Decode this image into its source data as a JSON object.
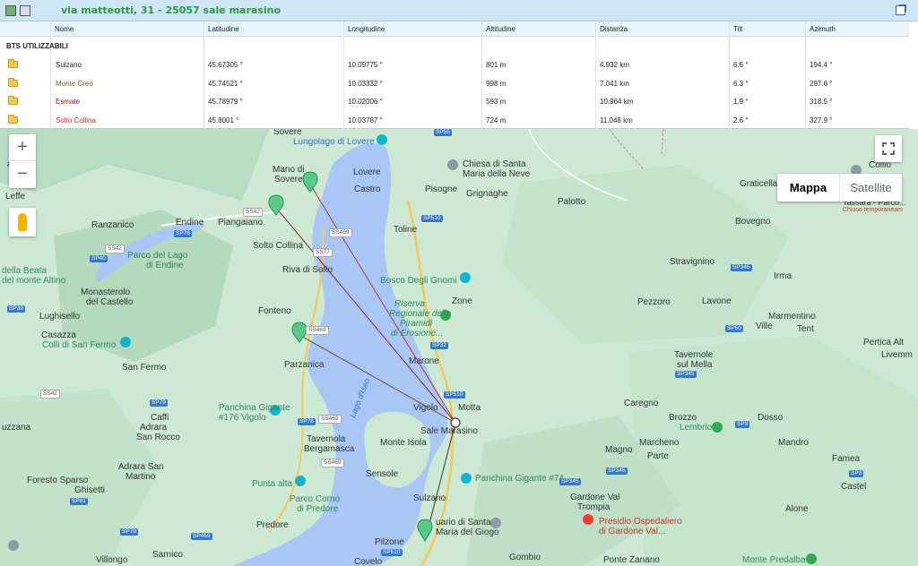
{
  "header": {
    "address": "via matteotti, 31 - 25057 sale marasino",
    "icons": [
      "map-icon",
      "print-icon",
      "external-link-icon"
    ]
  },
  "table": {
    "columns": [
      "Nome",
      "Latitudine",
      "Longitudine",
      "Altitudine",
      "Distanza",
      "Tilt",
      "Azimuth"
    ],
    "group_label": "BTS UTILIZZABILI",
    "rows": [
      {
        "name": "Sulzano",
        "lat": "45.67305 °",
        "lon": "10.09775 °",
        "alt": "801 m",
        "dist": "4.932 km",
        "tilt": "6.6 °",
        "az": "194.4 °",
        "color": "#222222"
      },
      {
        "name": "Monte Creò",
        "lat": "45.74521 °",
        "lon": "10.03332 °",
        "alt": "998 m",
        "dist": "7.041 km",
        "tilt": "6.3 °",
        "az": "297.6 °",
        "color": "#7a5a2a"
      },
      {
        "name": "Esmate",
        "lat": "45.78979 °",
        "lon": "10.02006 °",
        "alt": "593 m",
        "dist": "10.964 km",
        "tilt": "1.9 °",
        "az": "318.5 °",
        "color": "#8b1a1a"
      },
      {
        "name": "Solto Collina",
        "lat": "45.8001 °",
        "lon": "10.03787 °",
        "alt": "724 m",
        "dist": "11.048 km",
        "tilt": "2.6 °",
        "az": "327.9 °",
        "color": "#d42a2a"
      }
    ]
  },
  "map": {
    "controls": {
      "zoom_in": "+",
      "zoom_out": "−",
      "map_label": "Mappa",
      "satellite_label": "Satellite"
    },
    "places": {
      "sovere": "Sovere",
      "lungolago": "Lungolago di Lovere",
      "mano_di": "Mano di",
      "sovere2": "Sovere",
      "lovere": "Lovere",
      "chiesa1": "Chiesa di Santa",
      "chiesa2": "Maria della Neve",
      "castro": "Castro",
      "pisogne": "Pisogne",
      "grignaghe": "Grignaghe",
      "palotto": "Palotto",
      "collio": "Collio",
      "graticella": "Graticella",
      "bovegno": "Bovegno",
      "ndino": "andino",
      "leffe": "Leffe",
      "ranzanico": "Ranzanico",
      "endine": "Endine",
      "piangaiano": "Piangaiano",
      "solto": "Solto Collina",
      "toline": "Toline",
      "parco1": "Parco del Lago",
      "parco2": "di Endine",
      "riva": "Riva di Solto",
      "beata1": "della Beata",
      "beata2": "del monte Altino",
      "monasterolo1": "Monasterolo",
      "monasterolo2": "del Castello",
      "bosco": "Bosco Degli Gnomi",
      "zone": "Zone",
      "riserva1": "Riserva",
      "riserva2": "Regionale delle",
      "riserva3": "Piramidi",
      "riserva4": "di Erosione...",
      "stravignino": "Stravignino",
      "irma": "Irma",
      "pezzoro": "Pezzoro",
      "lavone": "Lavone",
      "marmentino": "Marmentino",
      "ville": "Ville",
      "tent": "Tent",
      "lughisello": "Lughisello",
      "fonteno": "Fonteno",
      "casazza": "Casazza",
      "colli": "Colli di San Fermo",
      "pertica1": "Pertica Alt",
      "pertica2": "Livemm",
      "marone": "Marone",
      "parzanica": "Parzanica",
      "tavernole1": "Tavernole",
      "tavernole2": "sul Mella",
      "sanfermo": "San Fermo",
      "lagodiseo": "Lago d'Iseo",
      "caregno": "Caregno",
      "vigolo": "Vigolo",
      "motta": "Motta",
      "panchina1": "Panchina Gigante",
      "panchina2": "#176 Vigolo",
      "caffi": "Caffi",
      "adrara1": "Adrara",
      "adrara2": "San Rocco",
      "brozzo": "Brozzo",
      "lembrio": "Lembrio",
      "dosso": "Dosso",
      "salemarasino": "Sale Marasino",
      "uzzana": "uzzana",
      "tavernola1": "Tavernola",
      "tavernola2": "Bergamasca",
      "monteisola": "Monte Isola",
      "marcheno": "Marcheno",
      "magno": "Magno",
      "parte": "Parte",
      "mandro": "Mandro",
      "famea": "Famea",
      "adrarasm1": "Adrara San",
      "adrarasm2": "Martino",
      "forestosparso": "Foresto Sparso",
      "sensole": "Sensole",
      "panchina74": "Panchina Gigante #74",
      "castel": "Castel",
      "ghisetti": "Ghisetti",
      "puntaalta": "Punta alta",
      "parcocorno1": "Parco Corno",
      "parcocorno2": "di Predore",
      "gardone1": "Gardone Val",
      "gardone2": "Trompia",
      "alone": "Alone",
      "sulzano": "Sulzano",
      "presidio1": "Presidio Ospedaliero",
      "presidio2": "di Gardone Val...",
      "predore": "Predore",
      "santuario1": "uario di Santa",
      "santuario2": "Maria del Giogo",
      "sarnico": "Sarnico",
      "pilzone": "Pilzone",
      "gombio": "Gombio",
      "montepredalba": "Monte Predalba",
      "villongo": "Villongo",
      "covelo": "Covelo",
      "pontezanano": "Ponte Zanano",
      "tassara1": "Tassara - Parco...",
      "tassara2": "Chiuso temporaneam"
    },
    "roads": {
      "sp55": "SP55",
      "ss42a": "SS42",
      "sp76": "SP76",
      "ss469a": "SS469",
      "sp510a": "SP510",
      "ss42b": "SS42",
      "sp40": "SP40",
      "ss77": "SS77",
      "sp345a": "SP345",
      "sp39": "SP39",
      "ss469b": "SS469",
      "sp50": "SP50",
      "sp32": "SP32",
      "sp345b": "SP345",
      "ss42c": "SS42",
      "sp510b": "SP510",
      "sp79a": "SP79",
      "sp78": "SP78",
      "ss469c": "SS469",
      "sp3a": "SP3",
      "ss469d": "SS469",
      "sp345c": "SP345",
      "sp3b": "SP3",
      "sp81": "SP81",
      "sp345d": "SP345",
      "sp79b": "SP79",
      "sp469": "SP469",
      "sp510c": "SP510"
    }
  }
}
